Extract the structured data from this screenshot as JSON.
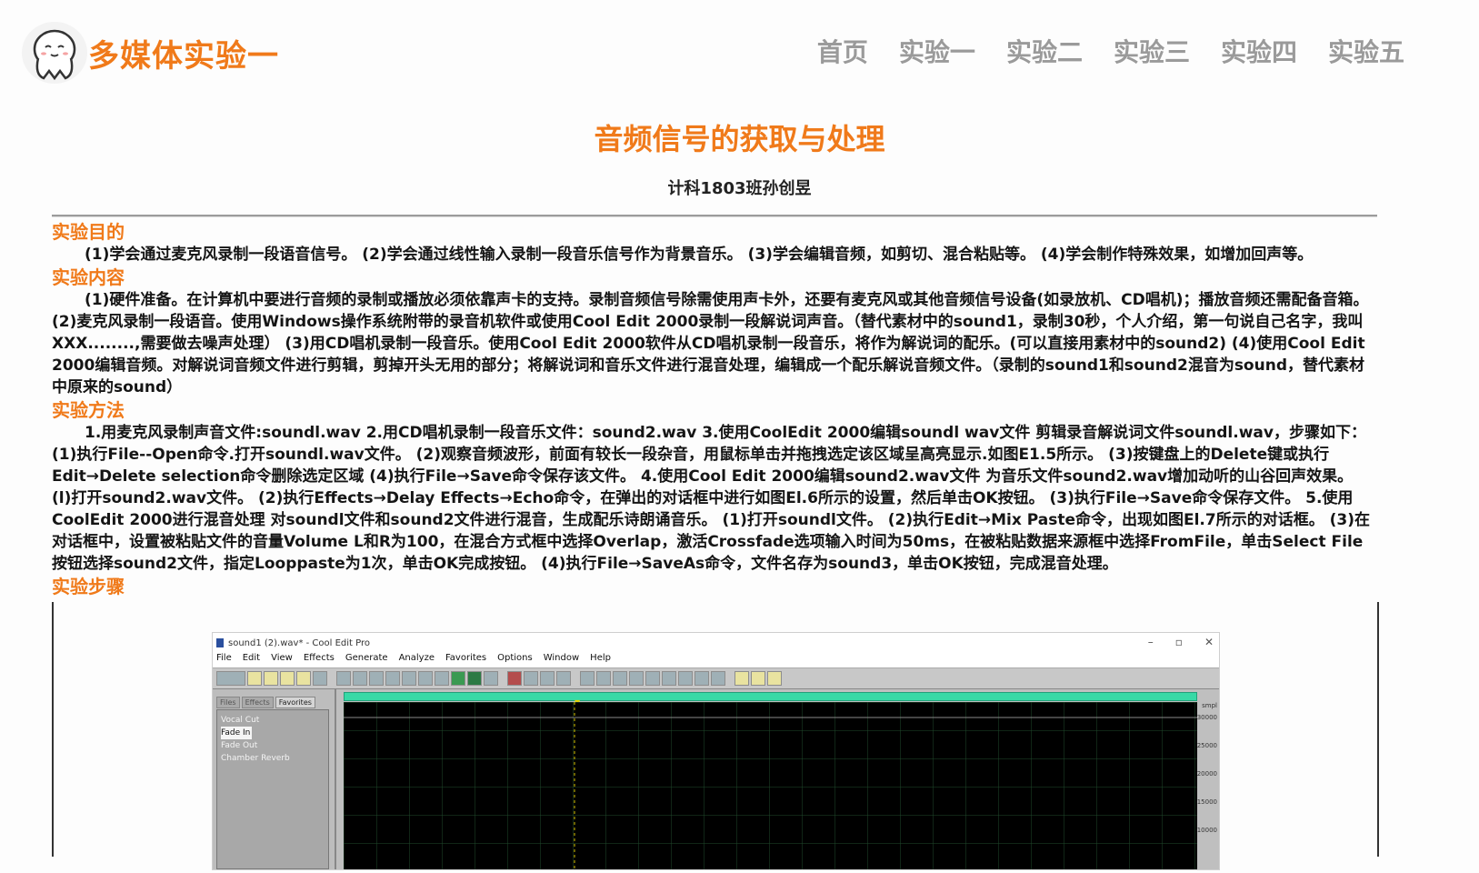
{
  "site": {
    "title": "多媒体实验一"
  },
  "nav": {
    "items": [
      "首页",
      "实验一",
      "实验二",
      "实验三",
      "实验四",
      "实验五"
    ]
  },
  "page": {
    "title": "音频信号的获取与处理",
    "author": "计科1803班孙创昱"
  },
  "sections": [
    {
      "heading": "实验目的",
      "text": "(1)学会通过麦克风录制一段语音信号。 (2)学会通过线性输入录制一段音乐信号作为背景音乐。 (3)学会编辑音频，如剪切、混合粘贴等。 (4)学会制作特殊效果，如增加回声等。"
    },
    {
      "heading": "实验内容",
      "text": "(1)硬件准备。在计算机中要进行音频的录制或播放必须依靠声卡的支持。录制音频信号除需使用声卡外，还要有麦克风或其他音频信号设备(如录放机、CD唱机)；播放音频还需配备音箱。 (2)麦克风录制一段语音。使用Windows操作系统附带的录音机软件或使用Cool Edit 2000录制一段解说词声音。（替代素材中的sound1，录制30秒，个人介绍，第一句说自己名字，我叫XXX........,需要做去噪声处理） (3)用CD唱机录制一段音乐。使用Cool Edit 2000软件从CD唱机录制一段音乐，将作为解说词的配乐。(可以直接用素材中的sound2) (4)使用Cool Edit 2000编辑音频。对解说词音频文件进行剪辑，剪掉开头无用的部分；将解说词和音乐文件进行混音处理，编辑成一个配乐解说音频文件。（录制的sound1和sound2混音为sound，替代素材中原来的sound）"
    },
    {
      "heading": "实验方法",
      "text": "1.用麦克风录制声音文件:soundl.wav 2.用CD唱机录制一段音乐文件：sound2.wav 3.使用CoolEdit 2000编辑soundl wav文件 剪辑录音解说词文件soundl.wav，步骤如下： (1)执行File--Open命令.打开soundl.wav文件。 (2)观察音频波形，前面有较长一段杂音，用鼠标单击并拖拽选定该区域呈高亮显示.如图E1.5所示。 (3)按键盘上的Delete键或执行Edit→Delete selection命令删除选定区域 (4)执行File→Save命令保存该文件。 4.使用Cool Edit 2000编辑sound2.wav文件 为音乐文件sound2.wav增加动听的山谷回声效果。 (l)打开sound2.wav文件。 (2)执行Effects→Delay Effects→Echo命令，在弹出的对话框中进行如图El.6所示的设置，然后单击OK按钮。 (3)执行File→Save命令保存文件。 5.使用CoolEdit 2000进行混音处理 对soundl文件和sound2文件进行混音，生成配乐诗朗诵音乐。 (1)打开soundl文件。 (2)执行Edit→Mix Paste命令，出现如图El.7所示的对话框。 (3)在对话框中，设置被粘贴文件的音量Volume L和R为100，在混合方式框中选择Overlap，激活Crossfade选项输入时间为50ms，在被粘贴数据来源框中选择FromFile，单击Select File按钮选择sound2文件，指定Looppaste为1次，单击OK完成按钮。 (4)执行File→SaveAs命令，文件名存为sound3，单击OK按钮，完成混音处理。"
    },
    {
      "heading": "实验步骤",
      "text": ""
    }
  ],
  "screenshot": {
    "window_title": "sound1 (2).wav* - Cool Edit Pro",
    "menu": [
      "File",
      "Edit",
      "View",
      "Effects",
      "Generate",
      "Analyze",
      "Favorites",
      "Options",
      "Window",
      "Help"
    ],
    "pane_tabs": [
      "Files",
      "Effects",
      "Favorites"
    ],
    "favorites": [
      "Vocal Cut",
      "Fade In",
      "Fade Out",
      "Chamber Reverb"
    ],
    "amp_label": "smpl",
    "amp_ticks": [
      "30000",
      "25000",
      "20000",
      "15000",
      "10000"
    ]
  },
  "colors": {
    "accent": "#f07a1a",
    "nav": "#9a9a9a"
  }
}
